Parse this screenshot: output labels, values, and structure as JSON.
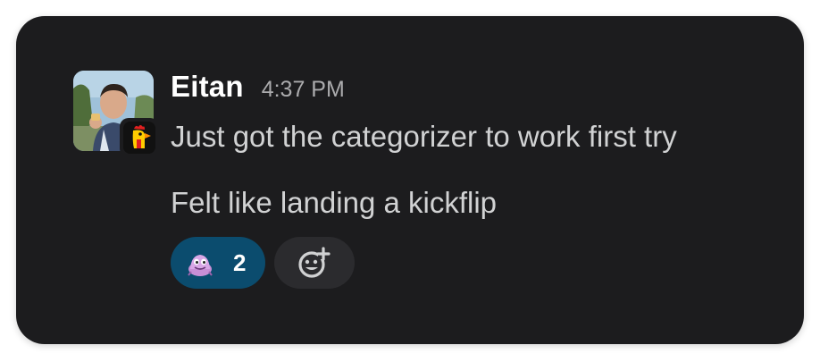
{
  "message": {
    "author": "Eitan",
    "time": "4:37 PM",
    "lines": [
      "Just got the categorizer to work first try",
      "Felt like landing a kickflip"
    ],
    "avatar_icon": "user-photo-avatar",
    "app_badge_icon": "rooster-app-badge-icon"
  },
  "reactions": [
    {
      "emoji_icon": "purple-creature-emoji-icon",
      "count": "2",
      "reacted_by_me": true
    }
  ],
  "add_reaction_icon": "add-emoji-icon",
  "colors": {
    "card_bg": "#1c1c1e",
    "author": "#ffffff",
    "timestamp": "#ababad",
    "body_text": "#d1d2d3",
    "reaction_active_bg": "#0b4c6e",
    "add_reaction_bg": "#2b2b2e"
  }
}
